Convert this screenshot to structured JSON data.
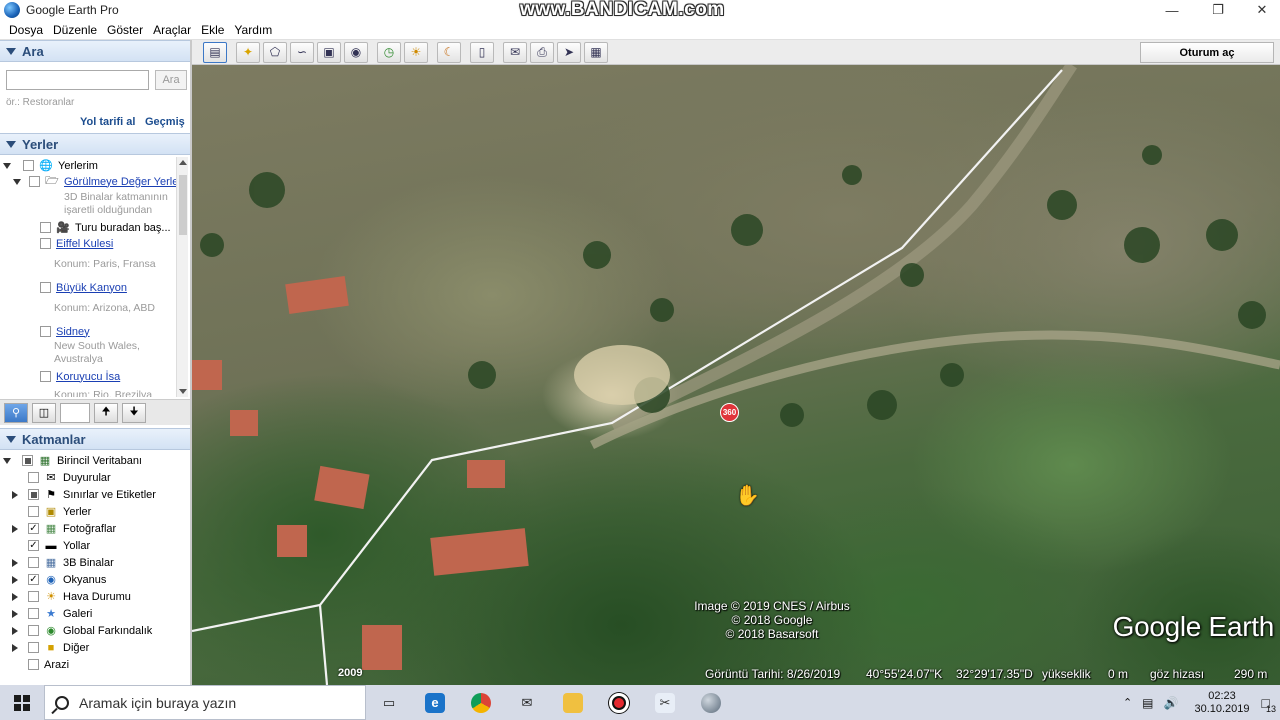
{
  "window": {
    "title": "Google Earth Pro",
    "watermark": "www.BANDICAM.com"
  },
  "menu": [
    "Dosya",
    "Düzenle",
    "Göster",
    "Araçlar",
    "Ekle",
    "Yardım"
  ],
  "toolbar": {
    "signin_label": "Oturum aç"
  },
  "search": {
    "header": "Ara",
    "button": "Ara",
    "placeholder": "",
    "hint": "ör.: Restoranlar",
    "directions_link": "Yol tarifi al",
    "history_link": "Geçmiş"
  },
  "places": {
    "header": "Yerler",
    "root": "Yerlerim",
    "folder": "Görülmeye Değer Yerler",
    "folder_desc1": "3D Binalar katmanının",
    "folder_desc2": "işaretli olduğundan",
    "tour": "Turu buradan baş...",
    "items": [
      {
        "name": "Eiffel Kulesi",
        "desc1": "Konum: Paris, Fransa",
        "desc2": ""
      },
      {
        "name": "Büyük Kanyon",
        "desc1": "Konum: Arizona, ABD",
        "desc2": ""
      },
      {
        "name": "Sidney",
        "desc1": "New South Wales,",
        "desc2": "Avustralya"
      },
      {
        "name": "Koruyucu İsa",
        "desc1": "Konum: Rio, Brezilya",
        "desc2": ""
      }
    ]
  },
  "layers": {
    "header": "Katmanlar",
    "root": "Birincil Veritabanı",
    "items": [
      {
        "label": "Duyurular",
        "checked": false,
        "expandable": false
      },
      {
        "label": "Sınırlar ve Etiketler",
        "checked": "partial",
        "expandable": true
      },
      {
        "label": "Yerler",
        "checked": false,
        "expandable": false
      },
      {
        "label": "Fotoğraflar",
        "checked": true,
        "expandable": true
      },
      {
        "label": "Yollar",
        "checked": true,
        "expandable": false
      },
      {
        "label": "3B Binalar",
        "checked": false,
        "expandable": true
      },
      {
        "label": "Okyanus",
        "checked": true,
        "expandable": true
      },
      {
        "label": "Hava Durumu",
        "checked": false,
        "expandable": true
      },
      {
        "label": "Galeri",
        "checked": false,
        "expandable": true
      },
      {
        "label": "Global Farkındalık",
        "checked": false,
        "expandable": true
      },
      {
        "label": "Diğer",
        "checked": false,
        "expandable": true
      },
      {
        "label": "Arazi",
        "checked": false,
        "expandable": false
      }
    ]
  },
  "map": {
    "credit1": "Image © 2019 CNES / Airbus",
    "credit2": "© 2018 Google",
    "credit3": "© 2018 Basarsoft",
    "logo": "Google Earth",
    "marker": "360",
    "year": "2009",
    "imagery_date": "Görüntü Tarihi: 8/26/2019",
    "lat": "40°55'24.07\"K",
    "lon": "32°29'17.35\"D",
    "elev_label": "yükseklik",
    "elev_value": "0 m",
    "eye_label": "göz hizası",
    "eye_value": "290 m"
  },
  "taskbar": {
    "search_placeholder": "Aramak için buraya yazın",
    "time": "02:23",
    "date": "30.10.2019",
    "notifications": "13"
  }
}
